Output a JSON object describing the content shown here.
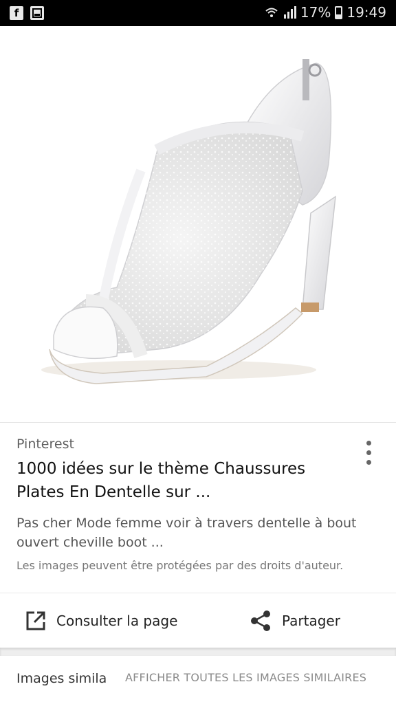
{
  "status_bar": {
    "left_icons": [
      "facebook-icon",
      "gallery-icon"
    ],
    "battery": "17%",
    "time": "19:49"
  },
  "result": {
    "image_alt_icon": "lace-peep-toe-heel-image",
    "source": "Pinterest",
    "title": "1000 idées sur le thème Chaussures Plates En Dentelle sur ...",
    "description": "Pas cher Mode femme voir à travers dentelle à bout ouvert cheville boot ...",
    "copyright": "Les images peuvent être protégées par des droits d'auteur."
  },
  "actions": {
    "consult_label": "Consulter la page",
    "share_label": "Partager"
  },
  "similar": {
    "label": "Images simila",
    "view_all": "AFFICHER TOUTES LES IMAGES SIMILAIRES"
  }
}
